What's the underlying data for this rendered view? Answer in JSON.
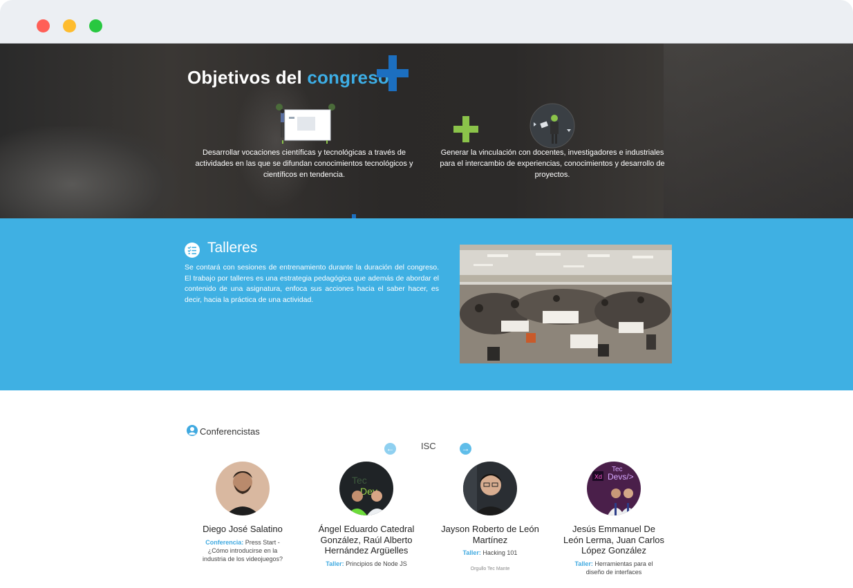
{
  "window": {
    "controls": [
      "close",
      "minimize",
      "maximize"
    ]
  },
  "hero": {
    "title_prefix": "Objetivos del",
    "title_accent": "congreso",
    "objectives": [
      {
        "text": "Desarrollar vocaciones científicas y tecnológicas a través de actividades en las que se difundan conocimientos tecnológicos y científicos en tendencia.",
        "illustration": "presentation-board-icon"
      },
      {
        "text": "Generar la vinculación con docentes, investigadores e industriales para el intercambio de experiencias, conocimientos y desarrollo de proyectos.",
        "illustration": "collaboration-icon"
      }
    ]
  },
  "talleres": {
    "title": "Talleres",
    "icon": "checklist-icon",
    "text": "Se contará con sesiones de entrenamiento durante la duración del congreso. El trabajo por talleres es una estrategia pedagógica que además de abordar el contenido de una asignatura, enfoca sus acciones hacia el saber hacer, es decir, hacia la práctica de una actividad."
  },
  "conferencistas": {
    "title": "Conferencistas",
    "icon": "user-circle-icon",
    "carousel_label": "ISC",
    "speakers": [
      {
        "name": "Diego José Salatino",
        "type": "Conferencia:",
        "topic": "Press Start - ¿Cómo introducirse en la industria de los videojuegos?",
        "note": ""
      },
      {
        "name": "Ángel Eduardo Catedral González, Raúl Alberto Hernández Argüelles",
        "type": "Taller:",
        "topic": "Principios de Node JS",
        "note": ""
      },
      {
        "name": "Jayson Roberto de León Martínez",
        "type": "Taller:",
        "topic": "Hacking 101",
        "note": "Orgullo Tec Mante"
      },
      {
        "name": "Jesús Emmanuel De León Lerma, Juan Carlos López González",
        "type": "Taller:",
        "topic": "Herramientas para el diseño de interfaces",
        "note": ""
      }
    ]
  },
  "colors": {
    "accent": "#3daee6",
    "talleres_bg": "#3fb0e3",
    "plus_blue": "#1c6fc0",
    "plus_green": "#8bc34a"
  }
}
